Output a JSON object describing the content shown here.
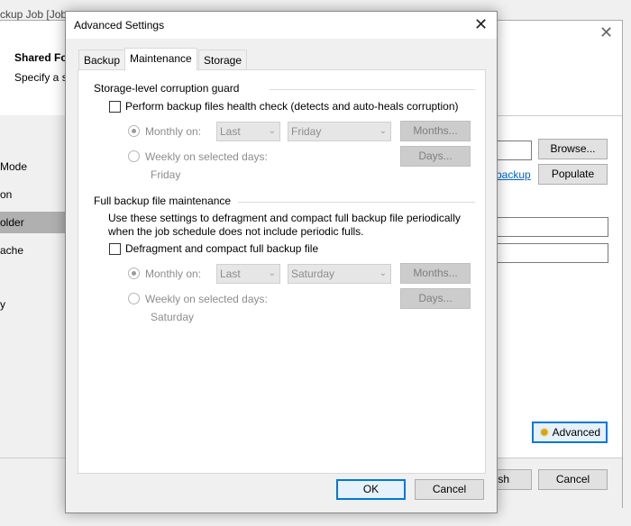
{
  "background": {
    "title": "ckup Job [Job",
    "header_bold": "Shared Fo",
    "header_sub": "Specify a s",
    "sidebar": [
      "Mode",
      "on",
      "older",
      "ache",
      "y"
    ],
    "browse_label": "Browse...",
    "populate_label": "Populate",
    "link_label": "backup",
    "advanced_label": "Advanced",
    "finish_label": "ish",
    "cancel_label": "Cancel"
  },
  "dialog": {
    "title": "Advanced Settings",
    "tabs": [
      "Backup",
      "Maintenance",
      "Storage"
    ],
    "active_tab": "Maintenance",
    "corruption": {
      "group_label": "Storage-level corruption guard",
      "checkbox_label": "Perform backup files health check (detects and auto-heals corruption)",
      "monthly_label": "Monthly on:",
      "monthly_week": "Last",
      "monthly_day": "Friday",
      "months_button": "Months...",
      "weekly_label": "Weekly on selected days:",
      "days_button": "Days...",
      "weekly_summary": "Friday"
    },
    "maintenance": {
      "group_label": "Full backup file maintenance",
      "description_line1": "Use these settings to defragment and compact full backup file periodically",
      "description_line2": "when the job schedule does not include periodic fulls.",
      "checkbox_label": "Defragment and compact full backup file",
      "monthly_label": "Monthly on:",
      "monthly_week": "Last",
      "monthly_day": "Saturday",
      "months_button": "Months...",
      "weekly_label": "Weekly on selected days:",
      "days_button": "Days...",
      "weekly_summary": "Saturday"
    },
    "ok_label": "OK",
    "cancel_label": "Cancel"
  }
}
